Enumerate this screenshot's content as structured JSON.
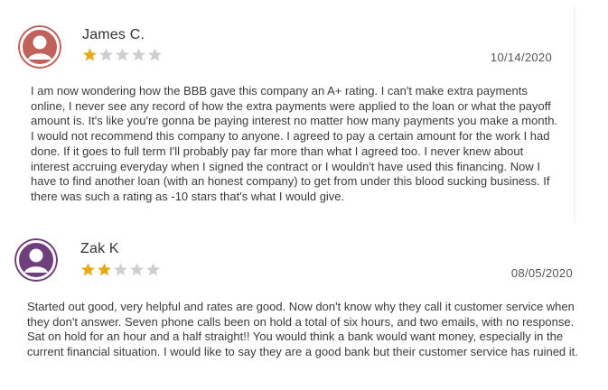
{
  "reviews": [
    {
      "name": "James C.",
      "rating": 1,
      "max_rating": 5,
      "date": "10/14/2020",
      "avatar_color": "#c0625a",
      "avatar_icon": "user-icon",
      "text": "I am now wondering how the BBB gave this company an A+ rating. I can't make extra payments online, I never see any record of how the extra payments were applied to the loan or what the payoff amount is. It's like you're gonna be paying interest no matter how many payments you make a month. I would not recommend this company to anyone. I agreed to pay a certain amount for the work I had done. If it goes to full term I'll probably pay far more than what I agreed too. I never knew about interest accruing everyday when I signed the contract or I wouldn't have used this financing. Now I have to find another loan (with an honest company) to get from under this blood sucking business. If there was such a rating as -10 stars that's what I would give."
    },
    {
      "name": "Zak K",
      "rating": 2,
      "max_rating": 5,
      "date": "08/05/2020",
      "avatar_color": "#6e3f7c",
      "avatar_icon": "user-icon",
      "text": "Started out good, very helpful and rates are good. Now don't know why they call it customer service when they don't answer. Seven phone calls been on hold a total of six hours, and two emails, with no response. Sat on hold for an hour and a half straight!! You would think a bank would want money, especially in the current financial situation. I would like to say they are a good bank but their customer service has ruined it."
    }
  ],
  "colors": {
    "star_filled": "#e6a817",
    "star_empty": "#cfcfcf"
  }
}
